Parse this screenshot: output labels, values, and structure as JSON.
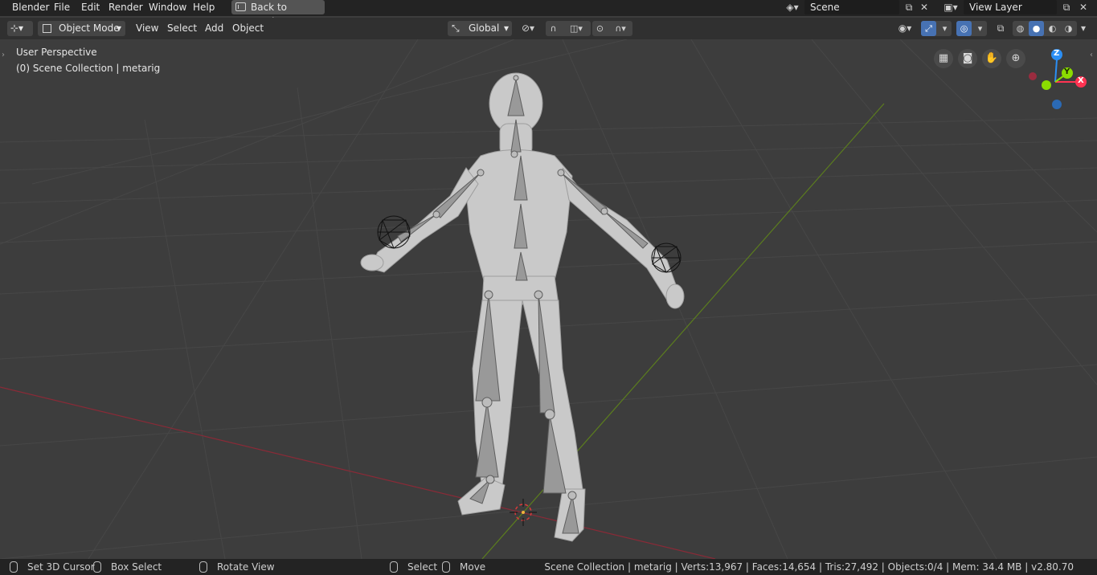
{
  "menubar": {
    "items": [
      "Blender",
      "File",
      "Edit",
      "Render",
      "Window",
      "Help"
    ],
    "back_button": "Back to Previous",
    "scene_name": "Scene",
    "view_layer_name": "View Layer"
  },
  "header": {
    "mode": "Object Mode",
    "menus": [
      "View",
      "Select",
      "Add",
      "Object"
    ],
    "transform_orientation": "Global"
  },
  "viewport": {
    "perspective_label": "User Perspective",
    "collection_label": "(0) Scene Collection | metarig",
    "gizmo_axes": [
      "Z",
      "Y",
      "X"
    ],
    "icons": {
      "nav": [
        "toggle-camera-grid-icon",
        "camera-view-icon",
        "pan-hand-icon",
        "zoom-icon"
      ]
    }
  },
  "statusbar": {
    "items": [
      "Set 3D Cursor",
      "Box Select",
      "Rotate View",
      "Select",
      "Move"
    ],
    "stats": "Scene Collection | metarig | Verts:13,967 | Faces:14,654 | Tris:27,492 | Objects:0/4 | Mem: 34.4 MB | v2.80.70"
  },
  "colors": {
    "x_axis": "#ff3352",
    "y_axis": "#8bdc00",
    "z_axis": "#2b8ff5",
    "active_blue": "#4772b3"
  }
}
